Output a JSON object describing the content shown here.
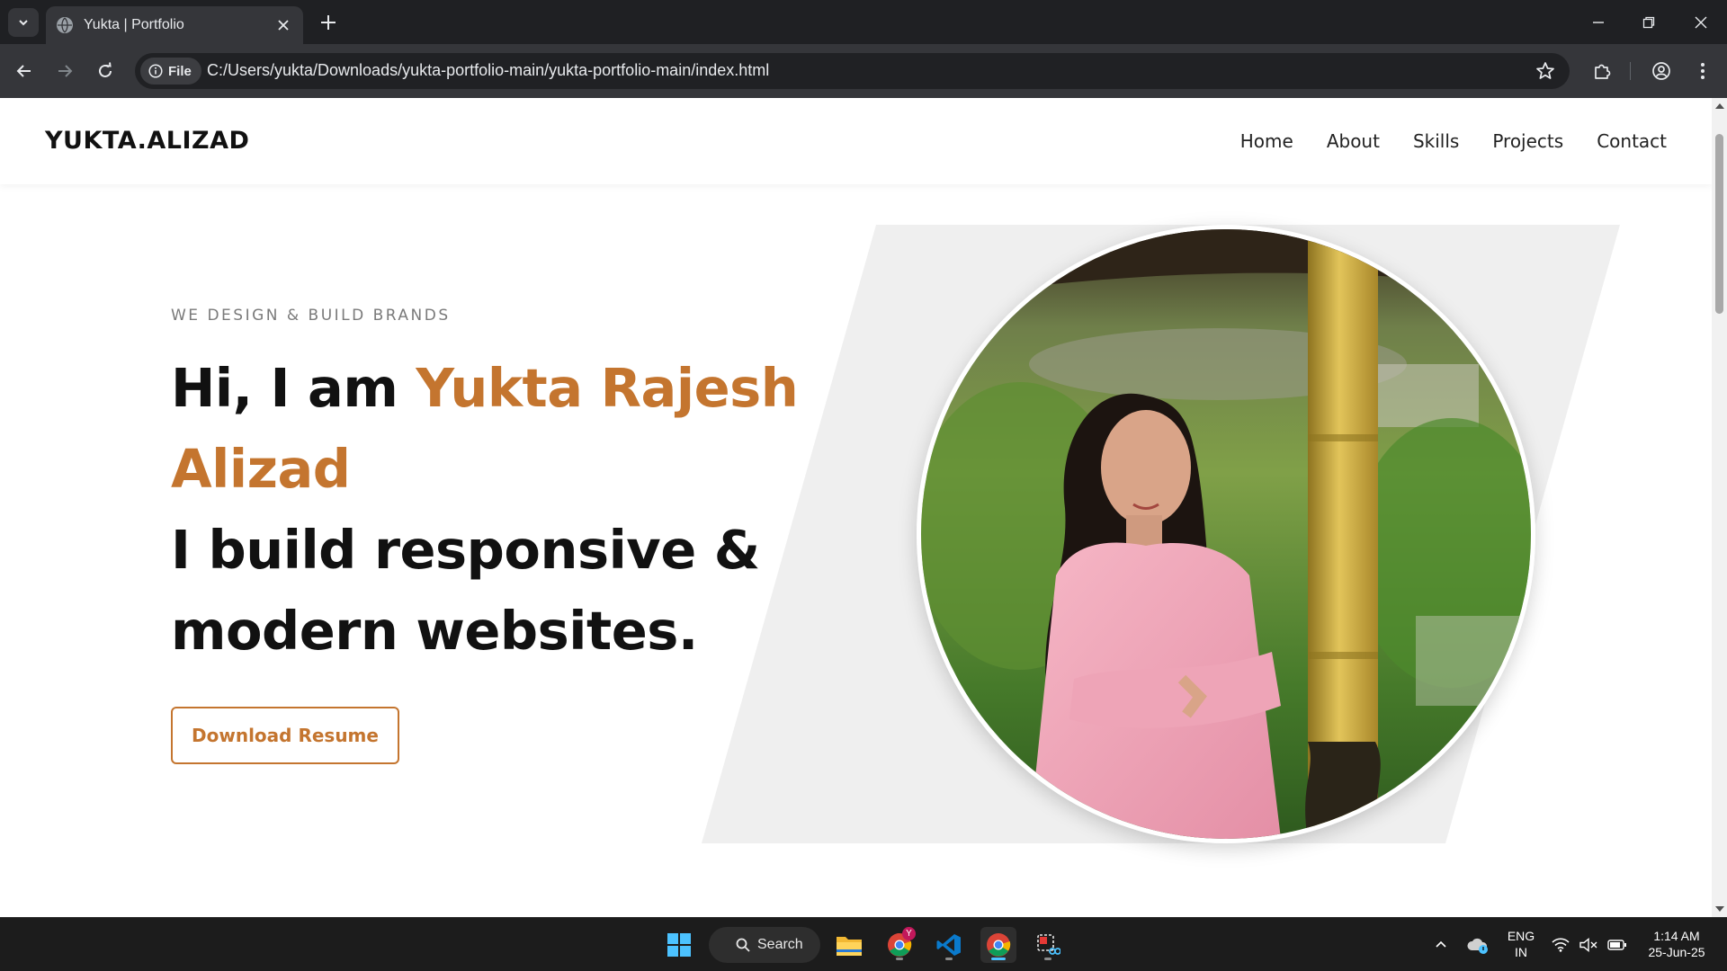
{
  "browser": {
    "tab_title": "Yukta | Portfolio",
    "address_chip": "File",
    "url": "C:/Users/yukta/Downloads/yukta-portfolio-main/yukta-portfolio-main/index.html"
  },
  "site": {
    "logo": "YUKTA.ALIZAD",
    "nav": [
      "Home",
      "About",
      "Skills",
      "Projects",
      "Contact"
    ],
    "hero": {
      "tagline": "WE DESIGN & BUILD BRANDS",
      "greeting": "Hi, I am ",
      "name": "Yukta Rajesh Alizad",
      "statement": "I build responsive & modern websites.",
      "button": "Download Resume"
    },
    "accent_color": "#c4752f"
  },
  "taskbar": {
    "search_label": "Search",
    "apps": [
      "windows-start-icon",
      "file-explorer-icon",
      "chrome-profile-icon",
      "vscode-icon",
      "chrome-icon",
      "snipping-tool-icon"
    ],
    "chrome_badge": "Y",
    "language": "ENG",
    "region": "IN",
    "time": "1:14 AM",
    "date": "25-Jun-25"
  }
}
